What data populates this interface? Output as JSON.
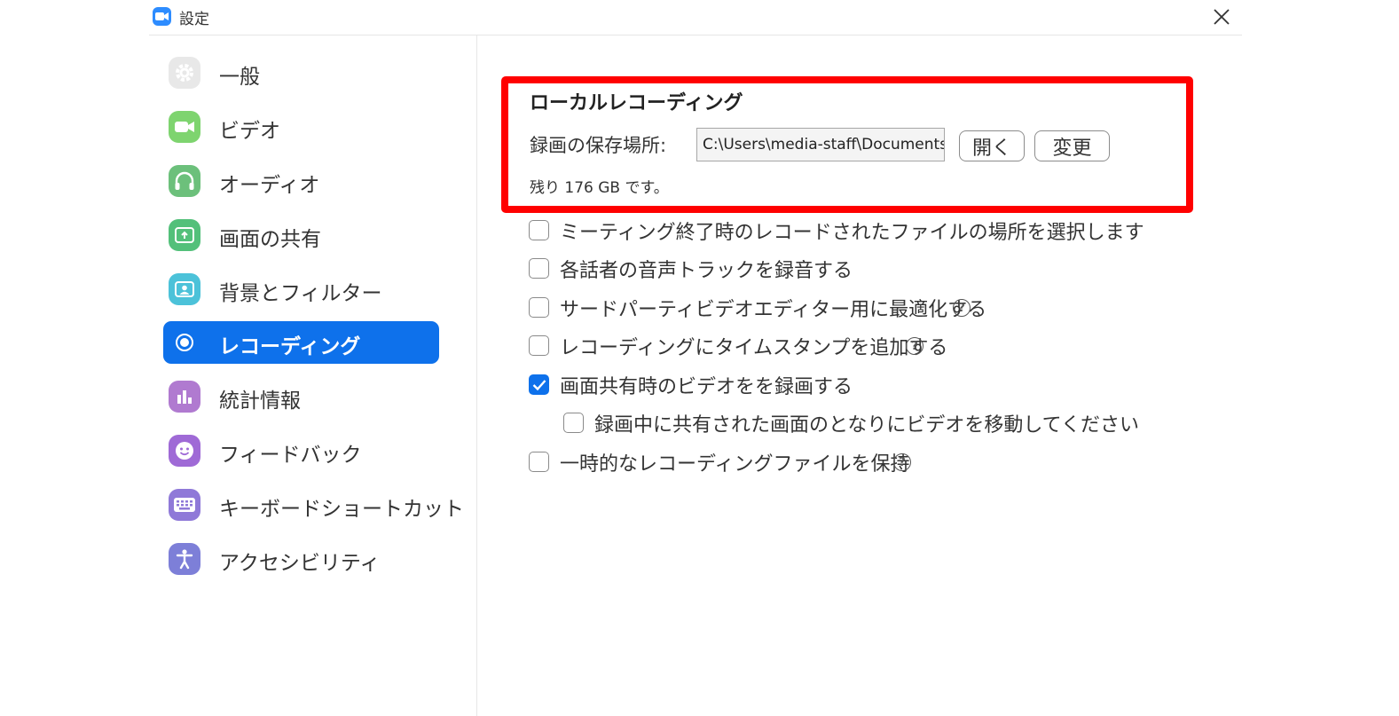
{
  "window": {
    "title": "設定"
  },
  "sidebar": {
    "items": [
      {
        "label": "一般",
        "icon": "gear-icon",
        "color": "#e8e8e8"
      },
      {
        "label": "ビデオ",
        "icon": "video-camera-icon",
        "color": "#7ed46f"
      },
      {
        "label": "オーディオ",
        "icon": "headphones-icon",
        "color": "#6cc07b"
      },
      {
        "label": "画面の共有",
        "icon": "share-screen-icon",
        "color": "#53c07a"
      },
      {
        "label": "背景とフィルター",
        "icon": "background-portrait-icon",
        "color": "#4cc2d9"
      },
      {
        "label": "レコーディング",
        "icon": "record-icon",
        "color": "#0e71eb",
        "active": true
      },
      {
        "label": "統計情報",
        "icon": "bar-chart-icon",
        "color": "#b07ad0"
      },
      {
        "label": "フィードバック",
        "icon": "smiley-icon",
        "color": "#9f6ad6"
      },
      {
        "label": "キーボードショートカット",
        "icon": "keyboard-icon",
        "color": "#8f79d8"
      },
      {
        "label": "アクセシビリティ",
        "icon": "accessibility-icon",
        "color": "#7d7fd8"
      }
    ]
  },
  "local_recording": {
    "title": "ローカルレコーディング",
    "location_label": "録画の保存場所:",
    "path_value": "C:\\Users\\media-staff\\Documents\\Zoom",
    "open_label": "開く",
    "change_label": "変更",
    "free_space": "残り 176 GB です。"
  },
  "options": [
    {
      "label": "ミーティング終了時のレコードされたファイルの場所を選択します",
      "checked": false,
      "help": false
    },
    {
      "label": "各話者の音声トラックを録音する",
      "checked": false,
      "help": false
    },
    {
      "label": "サードパーティビデオエディター用に最適化する",
      "checked": false,
      "help": true
    },
    {
      "label": "レコーディングにタイムスタンプを追加する",
      "checked": false,
      "help": true
    },
    {
      "label": "画面共有時のビデオをを録画する",
      "checked": true,
      "help": false
    },
    {
      "label": "録画中に共有された画面のとなりにビデオを移動してください",
      "checked": false,
      "help": false
    },
    {
      "label": "一時的なレコーディングファイルを保持",
      "checked": false,
      "help": true
    }
  ],
  "help_glyph": "?",
  "accent_color": "#0e71eb",
  "highlight_color": "#ff0000"
}
